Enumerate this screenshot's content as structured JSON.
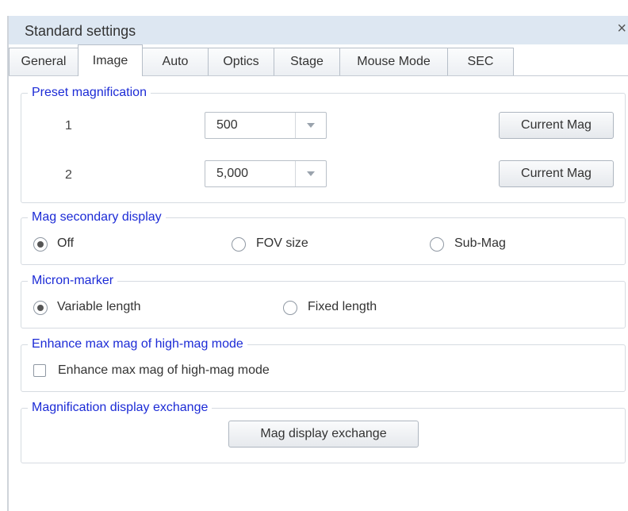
{
  "window": {
    "title": "Standard settings",
    "close_glyph": "×"
  },
  "tabs": [
    {
      "label": "General"
    },
    {
      "label": "Image"
    },
    {
      "label": "Auto"
    },
    {
      "label": "Optics"
    },
    {
      "label": "Stage"
    },
    {
      "label": "Mouse Mode"
    },
    {
      "label": "SEC"
    }
  ],
  "active_tab": "Image",
  "preset_magnification": {
    "title": "Preset magnification",
    "rows": [
      {
        "index": "1",
        "value": "500",
        "button": "Current Mag"
      },
      {
        "index": "2",
        "value": "5,000",
        "button": "Current Mag"
      }
    ]
  },
  "mag_secondary_display": {
    "title": "Mag secondary display",
    "options": [
      "Off",
      "FOV size",
      "Sub-Mag"
    ],
    "selected": "Off"
  },
  "micron_marker": {
    "title": "Micron-marker",
    "options": [
      "Variable length",
      "Fixed length"
    ],
    "selected": "Variable length"
  },
  "enhance_max_mag": {
    "title": "Enhance max mag of high-mag mode",
    "checkbox_label": "Enhance max mag of high-mag mode",
    "checked": false
  },
  "magnification_display_exchange": {
    "title": "Magnification display exchange",
    "button": "Mag display exchange"
  },
  "colors": {
    "group_title": "#1c2bd6",
    "titlebar": "#dde7f2"
  }
}
